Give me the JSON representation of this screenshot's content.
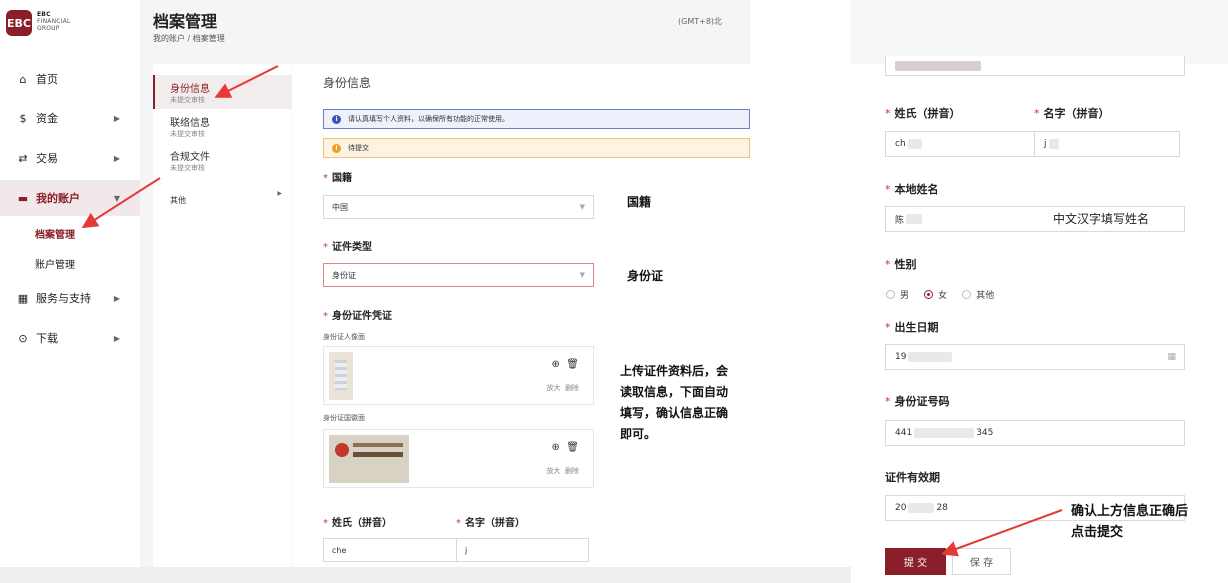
{
  "brand": {
    "mark": "EBC",
    "line1": "EBC",
    "line2": "FINANCIAL",
    "line3": "GROUP"
  },
  "nav": [
    {
      "label": "首页",
      "icon": "home-icon",
      "glyph": "⌂",
      "has_chevron": false
    },
    {
      "label": "资金",
      "icon": "dollar-icon",
      "glyph": "$",
      "has_chevron": true
    },
    {
      "label": "交易",
      "icon": "trade-icon",
      "glyph": "⇄",
      "has_chevron": true
    },
    {
      "label": "我的账户",
      "icon": "folder-icon",
      "glyph": "▬",
      "has_chevron": true
    },
    {
      "label": "服务与支持",
      "icon": "grid-icon",
      "glyph": "▦",
      "has_chevron": true
    },
    {
      "label": "下载",
      "icon": "download-icon",
      "glyph": "⊙",
      "has_chevron": true
    }
  ],
  "subnav": [
    "档案管理",
    "账户管理"
  ],
  "header": {
    "title": "档案管理",
    "breadcrumb": "我的账户 / 档案管理",
    "timezone": "(GMT+8)北"
  },
  "tabs": [
    {
      "label": "身份信息",
      "sub": "未提交审核"
    },
    {
      "label": "联络信息",
      "sub": "未提交审核"
    },
    {
      "label": "合规文件",
      "sub": "未提交审核"
    },
    {
      "label": "其他",
      "sub": ""
    }
  ],
  "form": {
    "section_title": "身份信息",
    "info_text": "请认真填写个人资料，以确保所有功能的正常使用。",
    "warn_text": "待提交",
    "nationality_label": "国籍",
    "nationality_value": "中国",
    "idtype_label": "证件类型",
    "idtype_value": "身份证",
    "cred_label": "身份证件凭证",
    "front_label": "身份证人像面",
    "back_label": "身份证国徽面",
    "zoom_label": "放大",
    "delete_label": "删除",
    "surname_label": "姓氏（拼音）",
    "given_label": "名字（拼音）",
    "surname_value": "che",
    "given_value": "j"
  },
  "annotations": {
    "nationality": "国籍",
    "idtype": "身份证",
    "upload_note": [
      "上传证件资料后，会",
      "读取信息，下面自动",
      "填写，确认信息正确",
      "即可。"
    ],
    "local_name_note": "中文汉字填写姓名",
    "submit_note": [
      "确认上方信息正确后",
      "点击提交"
    ]
  },
  "right": {
    "surname_label": "姓氏（拼音）",
    "given_label": "名字（拼音）",
    "surname_value": "ch",
    "given_value": "j",
    "local_name_label": "本地姓名",
    "local_name_value": "陈",
    "gender_label": "性别",
    "gender_options": [
      "男",
      "女",
      "其他"
    ],
    "gender_selected": "女",
    "dob_label": "出生日期",
    "dob_value": "19",
    "idno_label": "身份证号码",
    "idno_prefix": "441",
    "idno_suffix": "345",
    "validity_label": "证件有效期",
    "validity_prefix": "20",
    "validity_suffix": "28",
    "submit_label": "提 交",
    "save_label": "保 存"
  },
  "colors": {
    "brand": "#8a1f2a",
    "arrow": "#e53935"
  }
}
